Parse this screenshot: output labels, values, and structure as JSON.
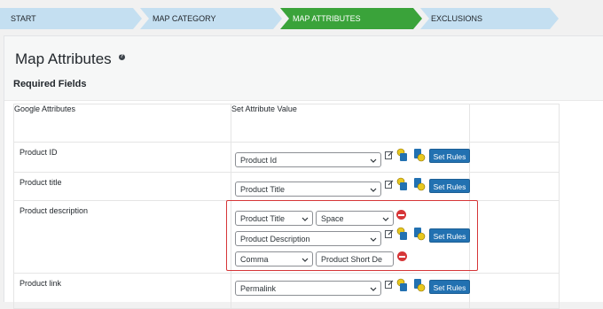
{
  "steps": [
    {
      "label": "START",
      "active": false
    },
    {
      "label": "MAP CATEGORY",
      "active": false
    },
    {
      "label": "MAP ATTRIBUTES",
      "active": true
    },
    {
      "label": "EXCLUSIONS",
      "active": false
    }
  ],
  "colors": {
    "step_inactive": "#c4dff1",
    "step_active": "#3aa33a",
    "button": "#2271b1",
    "highlight": "#d63638"
  },
  "page": {
    "title": "Map Attributes",
    "help_icon": "question-icon",
    "section": "Required Fields"
  },
  "table": {
    "headers": [
      "Google Attributes",
      "Set Attribute Value"
    ],
    "rows": [
      {
        "label": "Product ID",
        "value": "Product Id",
        "button": "Set Rules"
      },
      {
        "label": "Product title",
        "value": "Product Title",
        "button": "Set Rules"
      },
      {
        "label": "Product description",
        "values": [
          [
            "Product Title",
            "Space"
          ],
          [
            "Product Description"
          ],
          [
            "Comma",
            "Product Short De"
          ]
        ],
        "button": "Set Rules"
      },
      {
        "label": "Product link",
        "value": "Permalink",
        "button": "Set Rules"
      }
    ]
  }
}
